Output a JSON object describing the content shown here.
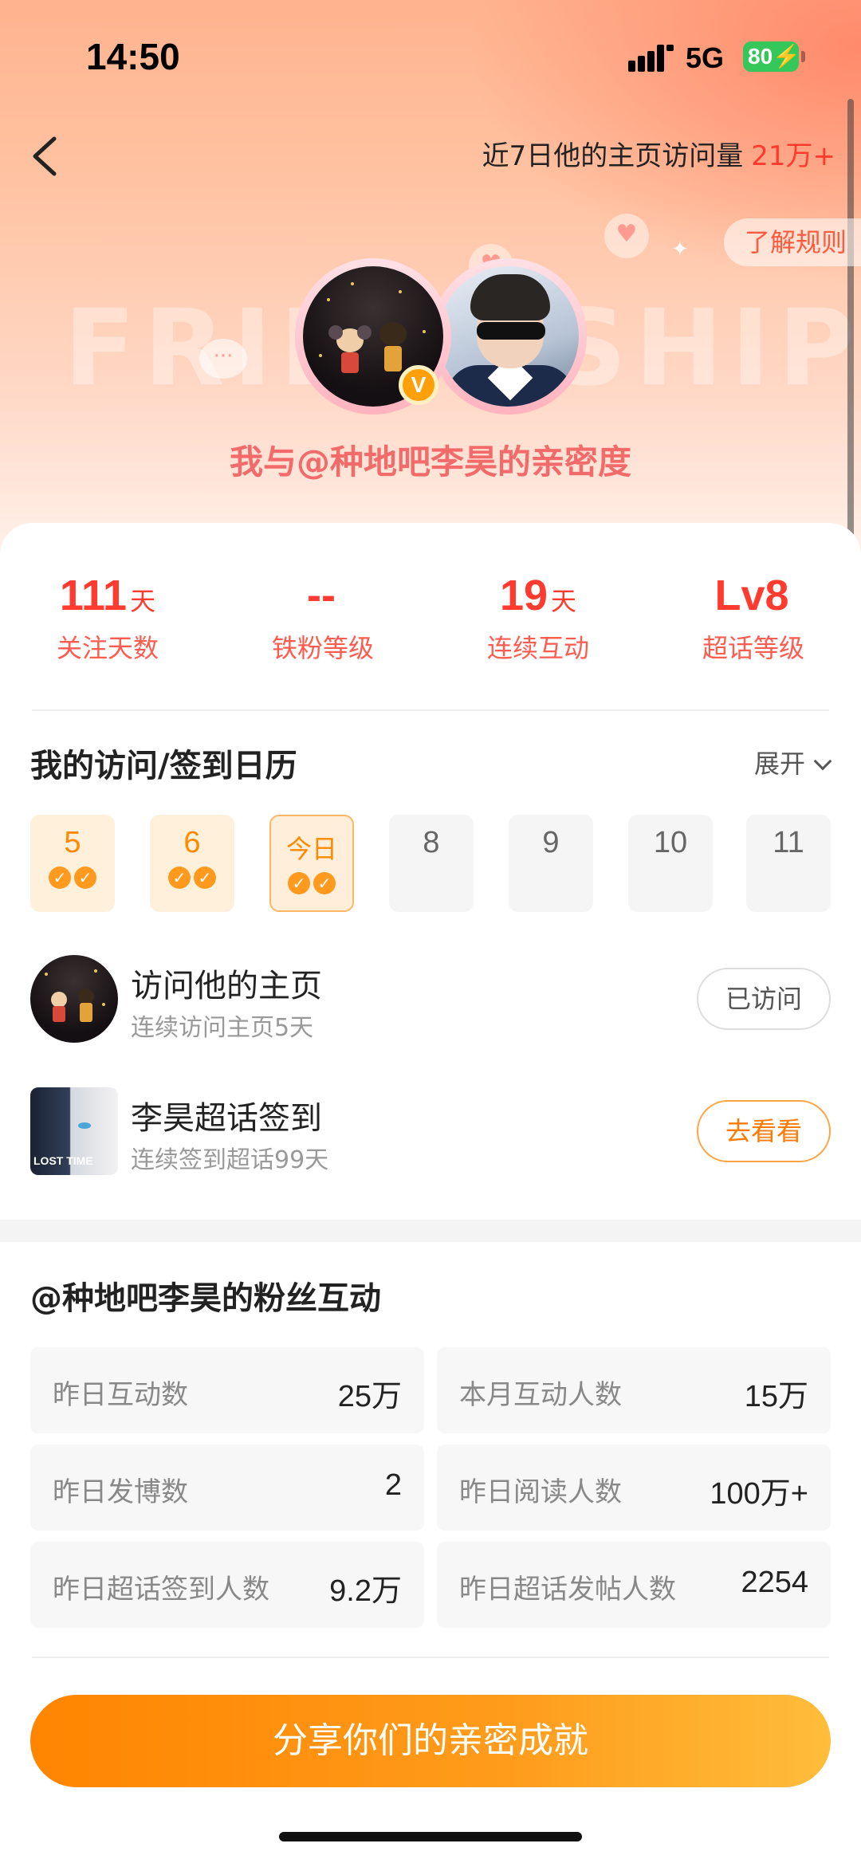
{
  "status_bar": {
    "time": "14:50",
    "network": "5G",
    "battery": "80"
  },
  "nav": {
    "visit_label": "近7日他的主页访问量",
    "visit_count": "21万+",
    "rules_label": "了解规则"
  },
  "hero": {
    "watermark": "FRIENDSHIP",
    "title": "我与@种地吧李昊的亲密度"
  },
  "stats": [
    {
      "value": "111",
      "unit": "天",
      "label": "关注天数"
    },
    {
      "value": "--",
      "unit": "",
      "label": "铁粉等级"
    },
    {
      "value": "19",
      "unit": "天",
      "label": "连续互动"
    },
    {
      "value": "Lv8",
      "unit": "",
      "label": "超话等级"
    }
  ],
  "calendar": {
    "title": "我的访问/签到日历",
    "expand_label": "展开",
    "days": [
      {
        "label": "5",
        "state": "done"
      },
      {
        "label": "6",
        "state": "done"
      },
      {
        "label": "今日",
        "state": "today"
      },
      {
        "label": "8",
        "state": "pending"
      },
      {
        "label": "9",
        "state": "pending"
      },
      {
        "label": "10",
        "state": "pending"
      },
      {
        "label": "11",
        "state": "pending"
      }
    ]
  },
  "tasks": [
    {
      "title": "访问他的主页",
      "subtitle": "连续访问主页5天",
      "button": "已访问"
    },
    {
      "title": "李昊超话签到",
      "subtitle": "连续签到超话99天",
      "button": "去看看"
    }
  ],
  "task_art_text": "LOST TIME",
  "fans": {
    "title": "@种地吧李昊的粉丝互动",
    "cells": [
      {
        "label": "昨日互动数",
        "value": "25万"
      },
      {
        "label": "本月互动人数",
        "value": "15万"
      },
      {
        "label": "昨日发博数",
        "value": "2"
      },
      {
        "label": "昨日阅读人数",
        "value": "100万+"
      },
      {
        "label": "昨日超话签到人数",
        "value": "9.2万"
      },
      {
        "label": "昨日超话发帖人数",
        "value": "2254"
      }
    ]
  },
  "share_label": "分享你们的亲密成就",
  "colors": {
    "accent": "#ff3b30",
    "orange": "#ff8500",
    "pink_title": "#f26a6a"
  }
}
